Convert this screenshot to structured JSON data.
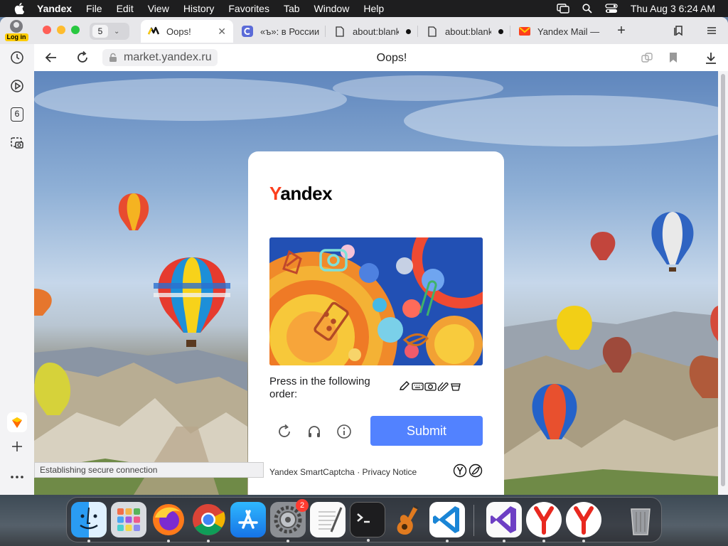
{
  "menubar": {
    "app_name": "Yandex",
    "items": [
      "File",
      "Edit",
      "View",
      "History",
      "Favorites",
      "Tab",
      "Window",
      "Help"
    ],
    "clock": "Thu Aug 3  6:24 AM"
  },
  "browser": {
    "login_label": "Log in",
    "tab_count": "5",
    "tabs": [
      {
        "title": "Oops!",
        "active": true
      },
      {
        "title": "«ъ»: в России",
        "active": false
      },
      {
        "title": "about:blank",
        "active": false
      },
      {
        "title": "about:blank",
        "active": false
      },
      {
        "title": "Yandex Mail —",
        "active": false
      }
    ],
    "url": "market.yandex.ru",
    "page_title": "Oops!",
    "sidebar_tab_count": "6",
    "status_text": "Establishing secure connection"
  },
  "captcha": {
    "logo_first": "Y",
    "logo_rest": "andex",
    "instruction": "Press in the following order:",
    "order_icons": [
      "pencil-icon",
      "keyboard-icon",
      "camera-icon",
      "paperclip-icon",
      "basket-icon"
    ],
    "submit_label": "Submit",
    "footer_brand": "Yandex SmartCaptcha",
    "footer_separator": "·",
    "footer_link": "Privacy Notice"
  },
  "dock": {
    "apps": [
      "Finder",
      "Launchpad",
      "Firefox",
      "Chrome",
      "App Store",
      "System Settings",
      "TextEdit",
      "Terminal",
      "GarageBand",
      "VS Code",
      "Visual Studio",
      "Yandex Browser",
      "Yandex Browser"
    ],
    "settings_badge": "2"
  },
  "colors": {
    "accent": "#5282ff",
    "yandex_red": "#fc3f1d",
    "menubar": "#1e1e1f"
  }
}
